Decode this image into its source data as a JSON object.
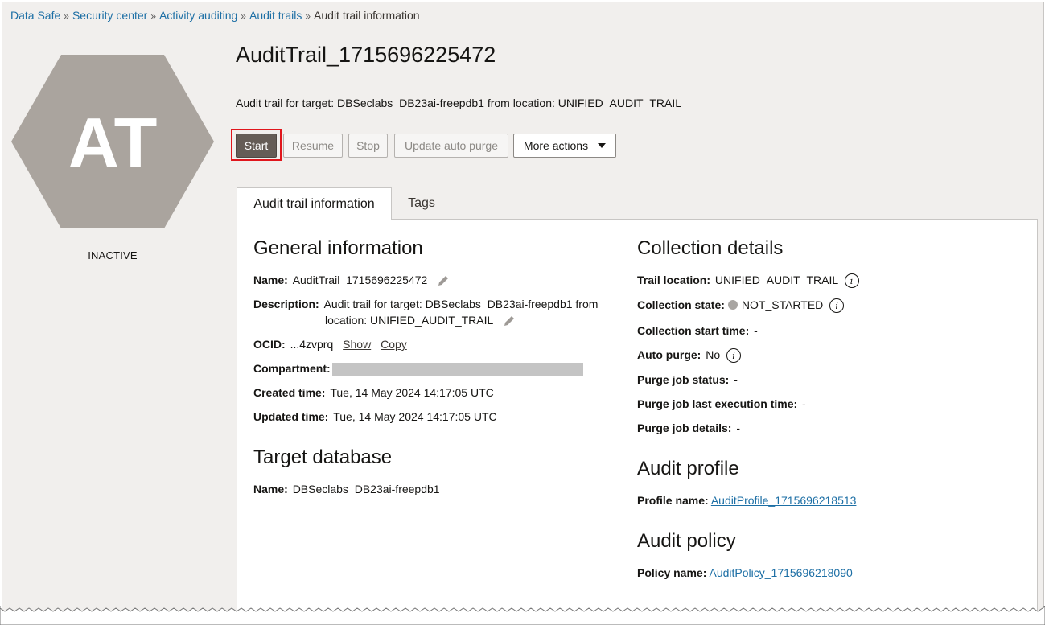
{
  "breadcrumb": {
    "items": [
      "Data Safe",
      "Security center",
      "Activity auditing",
      "Audit trails"
    ],
    "current": "Audit trail information",
    "separator": "»"
  },
  "badge": {
    "initials": "AT",
    "status": "INACTIVE",
    "color": "#aaa49e"
  },
  "header": {
    "title": "AuditTrail_1715696225472",
    "subtitle": "Audit trail for target: DBSeclabs_DB23ai-freepdb1 from location: UNIFIED_AUDIT_TRAIL"
  },
  "toolbar": {
    "start": "Start",
    "resume": "Resume",
    "stop": "Stop",
    "update_auto_purge": "Update auto purge",
    "more_actions": "More actions"
  },
  "tabs": [
    "Audit trail information",
    "Tags"
  ],
  "general": {
    "heading": "General information",
    "name_label": "Name:",
    "name_value": "AuditTrail_1715696225472",
    "description_label": "Description:",
    "description_line1": "Audit trail for target: DBSeclabs_DB23ai-freepdb1 from",
    "description_line2": "location: UNIFIED_AUDIT_TRAIL",
    "ocid_label": "OCID:",
    "ocid_value": "...4zvprq",
    "ocid_show": "Show",
    "ocid_copy": "Copy",
    "compartment_label": "Compartment:",
    "created_label": "Created time:",
    "created_value": "Tue, 14 May 2024 14:17:05 UTC",
    "updated_label": "Updated time:",
    "updated_value": "Tue, 14 May 2024 14:17:05 UTC"
  },
  "target": {
    "heading": "Target database",
    "name_label": "Name:",
    "name_value": "DBSeclabs_DB23ai-freepdb1"
  },
  "collection": {
    "heading": "Collection details",
    "trail_location_label": "Trail location:",
    "trail_location_value": "UNIFIED_AUDIT_TRAIL",
    "state_label": "Collection state:",
    "state_value": "NOT_STARTED",
    "start_time_label": "Collection start time:",
    "start_time_value": "-",
    "auto_purge_label": "Auto purge:",
    "auto_purge_value": "No",
    "purge_status_label": "Purge job status:",
    "purge_status_value": "-",
    "purge_last_label": "Purge job last execution time:",
    "purge_last_value": "-",
    "purge_details_label": "Purge job details:",
    "purge_details_value": "-"
  },
  "profile": {
    "heading": "Audit profile",
    "label": "Profile name:",
    "value": "AuditProfile_1715696218513"
  },
  "policy": {
    "heading": "Audit policy",
    "label": "Policy name:",
    "value": "AuditPolicy_1715696218090"
  },
  "icons": {
    "pencil": "pencil-icon",
    "info": "info-icon",
    "caret": "chevron-down-icon",
    "status_dot": "status-dot-icon"
  },
  "colors": {
    "link": "#1d6fa5",
    "primary_button": "#655c56",
    "highlight": "#e0161c",
    "background": "#f1efed"
  }
}
